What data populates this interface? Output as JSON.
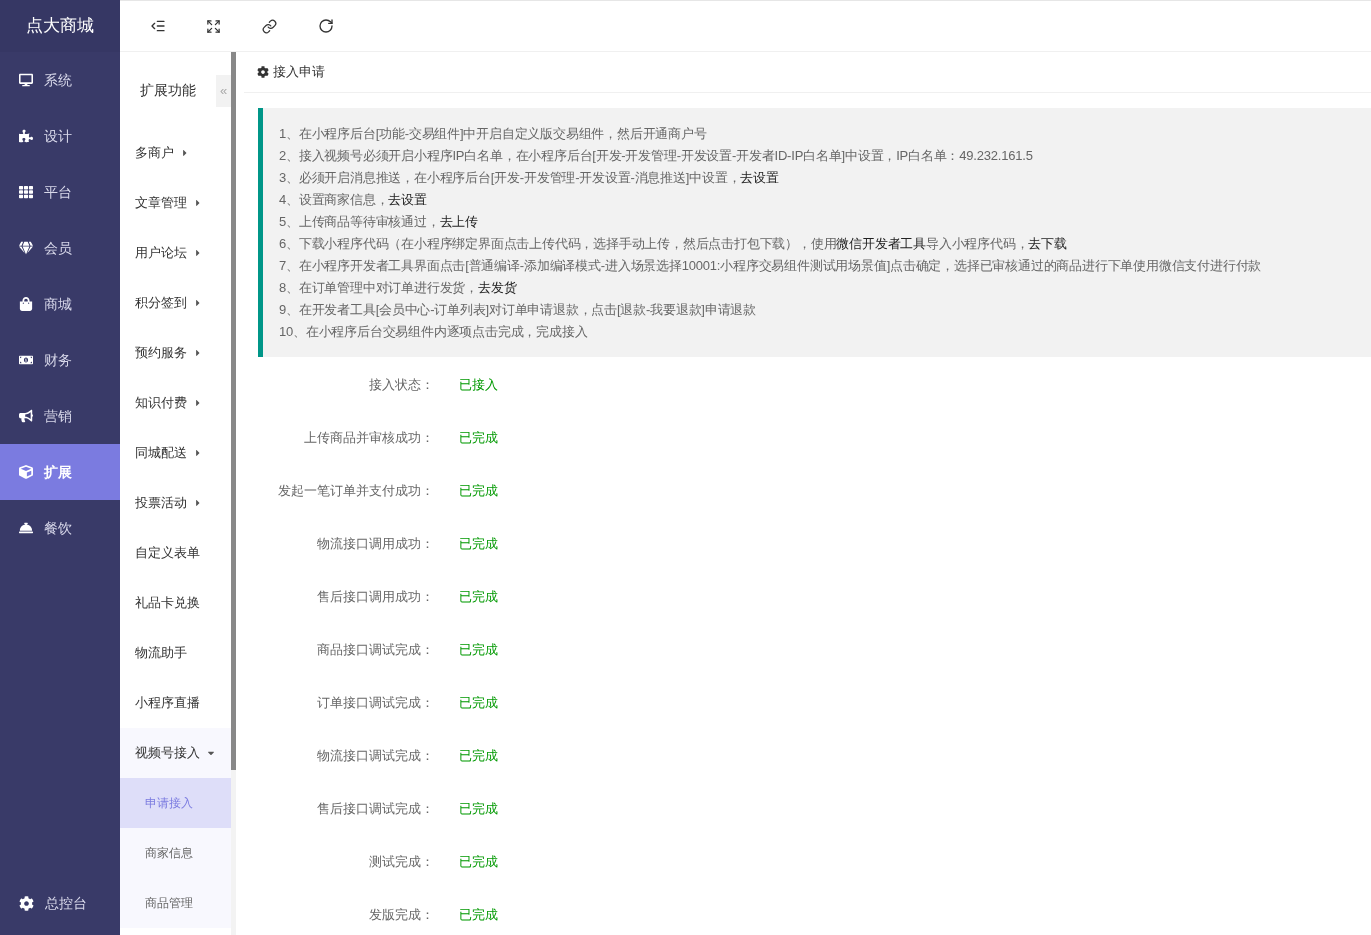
{
  "brand": "点大商城",
  "nav": [
    {
      "label": "系统",
      "selected": false
    },
    {
      "label": "设计",
      "selected": false
    },
    {
      "label": "平台",
      "selected": false
    },
    {
      "label": "会员",
      "selected": false
    },
    {
      "label": "商城",
      "selected": false
    },
    {
      "label": "财务",
      "selected": false
    },
    {
      "label": "营销",
      "selected": false
    },
    {
      "label": "扩展",
      "selected": true
    },
    {
      "label": "餐饮",
      "selected": false
    }
  ],
  "nav_footer": "总控台",
  "submenu": {
    "title": "扩展功能",
    "collapse_glyph": "«",
    "items": [
      {
        "label": "多商户",
        "has_children": true,
        "expanded": false
      },
      {
        "label": "文章管理",
        "has_children": true,
        "expanded": false
      },
      {
        "label": "用户论坛",
        "has_children": true,
        "expanded": false
      },
      {
        "label": "积分签到",
        "has_children": true,
        "expanded": false
      },
      {
        "label": "预约服务",
        "has_children": true,
        "expanded": false
      },
      {
        "label": "知识付费",
        "has_children": true,
        "expanded": false
      },
      {
        "label": "同城配送",
        "has_children": true,
        "expanded": false
      },
      {
        "label": "投票活动",
        "has_children": true,
        "expanded": false
      },
      {
        "label": "自定义表单",
        "has_children": false
      },
      {
        "label": "礼品卡兑换",
        "has_children": false
      },
      {
        "label": "物流助手",
        "has_children": false
      },
      {
        "label": "小程序直播",
        "has_children": false
      },
      {
        "label": "视频号接入",
        "has_children": true,
        "expanded": true,
        "children": [
          {
            "label": "申请接入",
            "selected": true
          },
          {
            "label": "商家信息",
            "selected": false
          },
          {
            "label": "商品管理",
            "selected": false
          }
        ]
      }
    ]
  },
  "page_title": "接入申请",
  "instructions": [
    [
      {
        "kind": "text",
        "text": "1、在小程序后台[功能-交易组件]中开启自定义版交易组件，然后开通商户号"
      }
    ],
    [
      {
        "kind": "text",
        "text": "2、接入视频号必须开启小程序IP白名单，在小程序后台[开发-开发管理-开发设置-开发者ID-IP白名单]中设置，IP白名单：49.232.161.5"
      }
    ],
    [
      {
        "kind": "text",
        "text": "3、必须开启消息推送，在小程序后台[开发-开发管理-开发设置-消息推送]中设置，"
      },
      {
        "kind": "link",
        "text": "去设置"
      }
    ],
    [
      {
        "kind": "text",
        "text": "4、设置商家信息，"
      },
      {
        "kind": "link",
        "text": "去设置"
      }
    ],
    [
      {
        "kind": "text",
        "text": "5、上传商品等待审核通过，"
      },
      {
        "kind": "link",
        "text": "去上传"
      }
    ],
    [
      {
        "kind": "text",
        "text": "6、下载小程序代码（在小程序绑定界面点击上传代码，选择手动上传，然后点击打包下载），使用"
      },
      {
        "kind": "link",
        "text": "微信开发者工具"
      },
      {
        "kind": "text",
        "text": "导入小程序代码，"
      },
      {
        "kind": "link",
        "text": "去下载"
      }
    ],
    [
      {
        "kind": "text",
        "text": "7、在小程序开发者工具界面点击[普通编译-添加编译模式-进入场景选择10001:小程序交易组件测试用场景值]点击确定，选择已审核通过的商品进行下单使用微信支付进行付款"
      }
    ],
    [
      {
        "kind": "text",
        "text": "8、在订单管理中对订单进行发货，"
      },
      {
        "kind": "link",
        "text": "去发货"
      }
    ],
    [
      {
        "kind": "text",
        "text": "9、在开发者工具[会员中心-订单列表]对订单申请退款，点击[退款-我要退款]申请退款"
      }
    ],
    [
      {
        "kind": "text",
        "text": "10、在小程序后台交易组件内逐项点击完成，完成接入"
      }
    ]
  ],
  "status": [
    {
      "label": "接入状态：",
      "value": "已接入"
    },
    {
      "label": "上传商品并审核成功：",
      "value": "已完成"
    },
    {
      "label": "发起一笔订单并支付成功：",
      "value": "已完成"
    },
    {
      "label": "物流接口调用成功：",
      "value": "已完成"
    },
    {
      "label": "售后接口调用成功：",
      "value": "已完成"
    },
    {
      "label": "商品接口调试完成：",
      "value": "已完成"
    },
    {
      "label": "订单接口调试完成：",
      "value": "已完成"
    },
    {
      "label": "物流接口调试完成：",
      "value": "已完成"
    },
    {
      "label": "售后接口调试完成：",
      "value": "已完成"
    },
    {
      "label": "测试完成：",
      "value": "已完成"
    },
    {
      "label": "发版完成：",
      "value": "已完成"
    }
  ]
}
